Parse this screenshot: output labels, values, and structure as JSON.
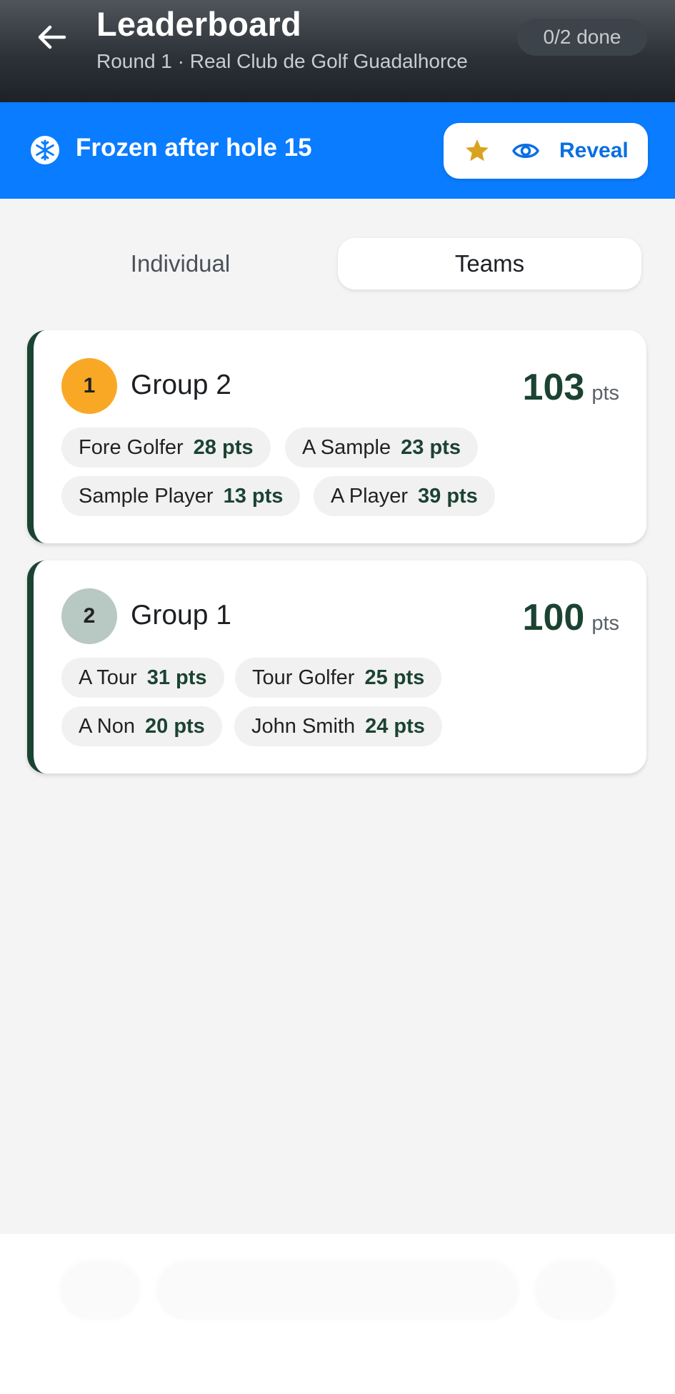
{
  "header": {
    "title": "Leaderboard",
    "subtitle": "Round 1 · Real Club de Golf Guadalhorce",
    "done_badge": "0/2 done"
  },
  "frozen_bar": {
    "text": "Frozen after hole 15",
    "reveal_label": "Reveal"
  },
  "tabs": {
    "individual": "Individual",
    "teams": "Teams",
    "selected": "Teams"
  },
  "colors": {
    "accent_blue": "#0a7cff",
    "score_green": "#1b4332",
    "rank_gold": "#f9a826",
    "rank_silver": "#b8c8c2",
    "star": "#d9a320"
  },
  "groups": [
    {
      "rank": "1",
      "name": "Group 2",
      "score": "103",
      "unit": "pts",
      "players": [
        {
          "name": "Fore Golfer",
          "pts": "28 pts"
        },
        {
          "name": "A Sample",
          "pts": "23 pts"
        },
        {
          "name": "Sample Player",
          "pts": "13 pts"
        },
        {
          "name": "A Player",
          "pts": "39 pts"
        }
      ]
    },
    {
      "rank": "2",
      "name": "Group 1",
      "score": "100",
      "unit": "pts",
      "players": [
        {
          "name": "A Tour",
          "pts": "31 pts"
        },
        {
          "name": "Tour Golfer",
          "pts": "25 pts"
        },
        {
          "name": "A Non",
          "pts": "20 pts"
        },
        {
          "name": "John Smith",
          "pts": "24 pts"
        }
      ]
    }
  ]
}
